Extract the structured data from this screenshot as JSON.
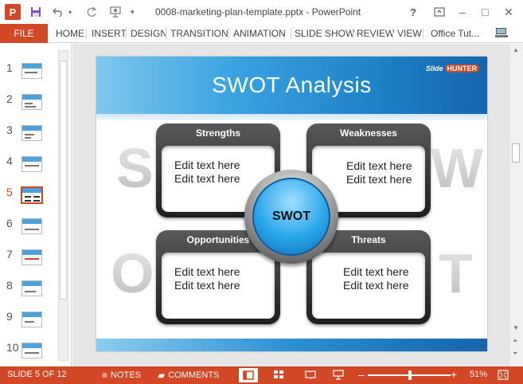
{
  "window": {
    "app_icon": "P",
    "title": "0008-marketing-plan-template.pptx - PowerPoint",
    "help": "?",
    "minimize": "–",
    "restore": "□",
    "close": "✕",
    "ribbon_display": "⊡"
  },
  "quick_access": {
    "save_icon": "floppy-disk-icon",
    "undo_icon": "undo-icon",
    "redo_icon": "redo-icon",
    "present_icon": "present-icon",
    "customize_icon": "chevron-down-icon"
  },
  "ribbon": {
    "file": "FILE",
    "tabs": [
      "HOME",
      "INSERT",
      "DESIGN",
      "TRANSITION",
      "ANIMATION",
      "SLIDE SHOW",
      "REVIEW",
      "VIEW",
      "Office Tut..."
    ]
  },
  "thumbnails": {
    "numbers": [
      "1",
      "2",
      "3",
      "4",
      "5",
      "6",
      "7",
      "8",
      "9",
      "10"
    ],
    "active": "5"
  },
  "slide": {
    "title": "SWOT Analysis",
    "logo_slide": "Slide",
    "logo_hunter": "HUNTER",
    "letters": [
      "S",
      "W",
      "O",
      "T"
    ],
    "center_label": "SWOT",
    "boxes": [
      {
        "heading": "Strengths",
        "line1": "Edit text here",
        "line2": "Edit text here"
      },
      {
        "heading": "Weaknesses",
        "line1": "Edit text here",
        "line2": "Edit text here"
      },
      {
        "heading": "Opportunities",
        "line1": "Edit text here",
        "line2": "Edit text here"
      },
      {
        "heading": "Threats",
        "line1": "Edit text here",
        "line2": "Edit text here"
      }
    ]
  },
  "statusbar": {
    "slide_info": "SLIDE 5 OF 12",
    "notes": "NOTES",
    "comments": "COMMENTS",
    "zoom_minus": "–",
    "zoom_plus": "+",
    "zoom": "51%",
    "zoom_fraction": 0.51
  },
  "colors": {
    "accent": "#d24726",
    "slide_blue": "#1b7fc6"
  }
}
